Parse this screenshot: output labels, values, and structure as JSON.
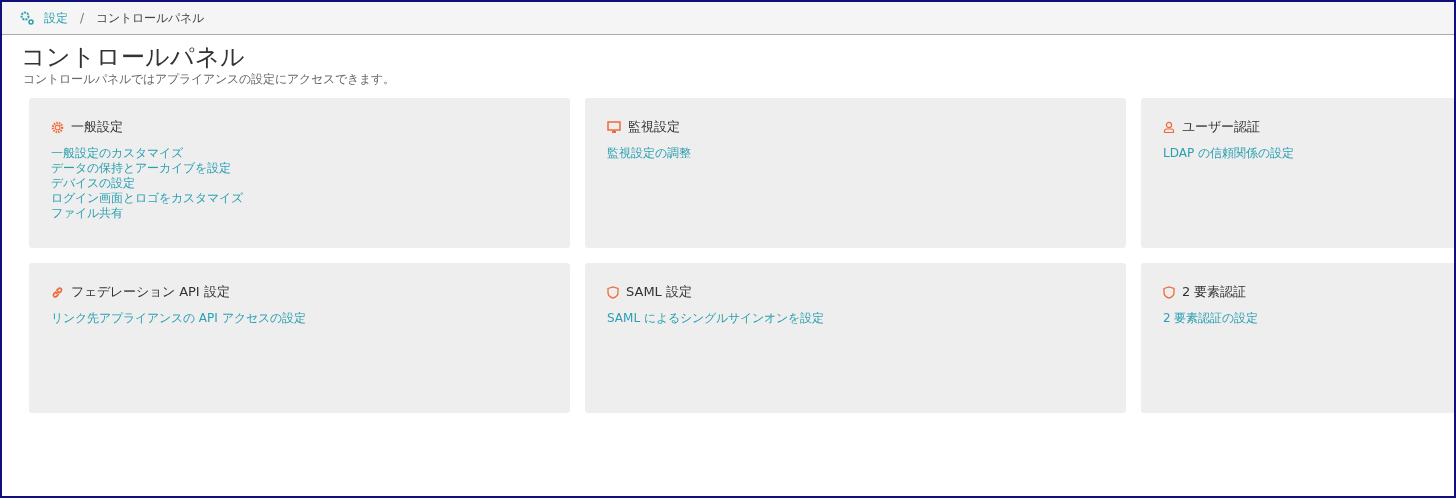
{
  "breadcrumb": {
    "separator": "/",
    "items": [
      {
        "label": "設定",
        "kind": "link"
      },
      {
        "label": "コントロールパネル",
        "kind": "current"
      }
    ]
  },
  "page": {
    "title": "コントロールパネル",
    "subtitle": "コントロールパネルではアプライアンスの設定にアクセスできます。"
  },
  "cards": [
    {
      "kind": "gear",
      "title": "一般設定",
      "links": [
        "一般設定のカスタマイズ",
        "データの保持とアーカイブを設定",
        "デバイスの設定",
        "ログイン画面とロゴをカスタマイズ",
        "ファイル共有"
      ]
    },
    {
      "kind": "monitor",
      "title": "監視設定",
      "links": [
        "監視設定の調整"
      ]
    },
    {
      "kind": "user",
      "title": "ユーザー認証",
      "links": [
        "LDAP の信頼関係の設定"
      ]
    },
    {
      "kind": "link",
      "title": "フェデレーション API 設定",
      "links": [
        "リンク先アプライアンスの API アクセスの設定"
      ]
    },
    {
      "kind": "shield",
      "title": "SAML 設定",
      "links": [
        "SAML によるシングルサインオンを設定"
      ]
    },
    {
      "kind": "shield",
      "title": "2 要素認証",
      "links": [
        "2 要素認証の設定"
      ]
    }
  ]
}
